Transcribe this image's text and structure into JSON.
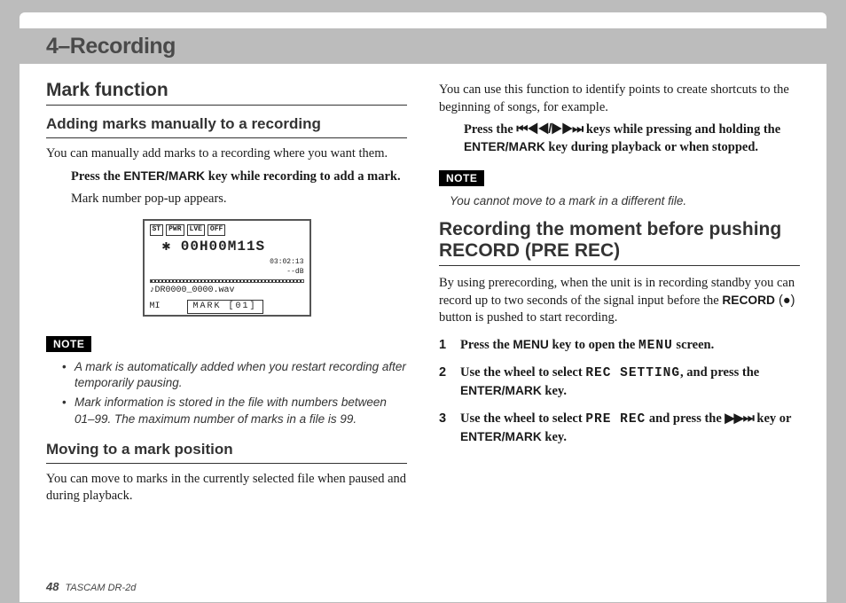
{
  "chapter": {
    "title": "4–Recording"
  },
  "left": {
    "h2": "Mark function",
    "sub1": "Adding marks manually to a recording",
    "p1": "You can manually add marks to a recording where you want them.",
    "instr1a": "Press the ",
    "instr1_key": "ENTER/MARK",
    "instr1b": " key while recording to add a mark.",
    "p2": "Mark number pop-up appears.",
    "lcd": {
      "tags": [
        "ST",
        "PWR",
        "LVE",
        "OFF"
      ],
      "timer": "00H00M11S",
      "sub": "03:02:13",
      "db": "--dB",
      "file": "♪DR0000_0000.wav",
      "left_lbl": "MI",
      "popup": "MARK [01]"
    },
    "note_label": "NOTE",
    "note1": "A mark is automatically added when you restart recording after temporarily pausing.",
    "note2": "Mark information is stored in the file with numbers between 01–99. The maximum number of marks in a file is 99.",
    "sub2": "Moving to a mark position",
    "p3": "You can move to marks in the currently selected file when paused and during playback."
  },
  "right": {
    "p1": "You can use this function to identify points to create shortcuts to the beginning of songs, for example.",
    "instr_a": "Press the ",
    "instr_glyph1": "⏮◀◀/▶▶⏭",
    "instr_b": " keys while pressing and holding the ",
    "instr_key": "ENTER/MARK",
    "instr_c": " key during playback or when stopped.",
    "note_label": "NOTE",
    "note_text": "You cannot move to a mark in a different file.",
    "h2": "Recording the moment before pushing RECORD (PRE REC)",
    "p2a": "By using prerecording, when the unit is in recording standby you can record up to two seconds of the signal input before the ",
    "p2_key": "RECORD",
    "p2_dot": " (●) ",
    "p2b": "button is pushed to start recording.",
    "s1a": "Press the ",
    "s1_key": "MENU",
    "s1b": " key to open the ",
    "s1_mono": "MENU",
    "s1c": " screen.",
    "s2a": "Use the wheel to select ",
    "s2_mono": "REC SETTING",
    "s2b": ", and press the ",
    "s2_key": "ENTER/MARK",
    "s2c": " key.",
    "s3a": "Use the wheel to select ",
    "s3_mono": "PRE REC",
    "s3b": " and press the ",
    "s3_glyph": "▶▶⏭",
    "s3c": " key or ",
    "s3_key": "ENTER/MARK",
    "s3d": " key."
  },
  "footer": {
    "page": "48",
    "product": "TASCAM  DR-2d"
  }
}
